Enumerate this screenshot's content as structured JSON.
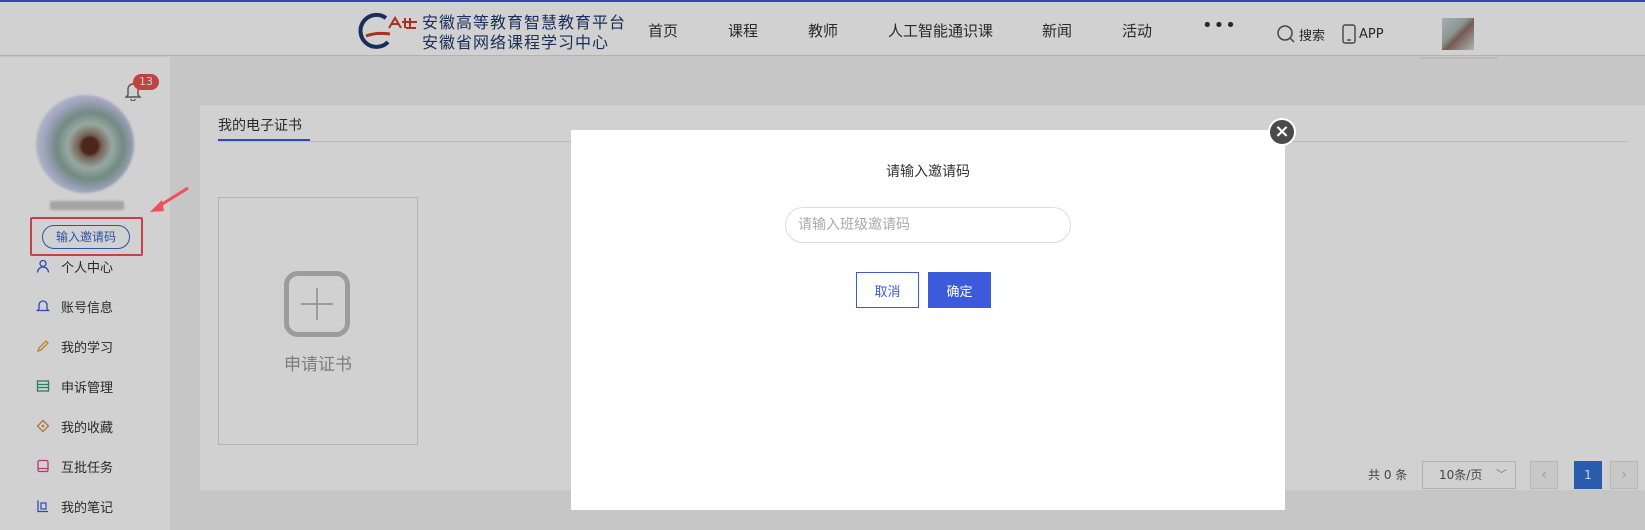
{
  "header": {
    "logo_line1": "安徽高等教育智慧教育平台",
    "logo_line2": "安徽省网络课程学习中心",
    "nav": [
      "首页",
      "课程",
      "教师",
      "人工智能通识课",
      "新闻",
      "活动"
    ],
    "more": "•••",
    "search_label": "搜索",
    "app_label": "APP"
  },
  "sidebar": {
    "notification_count": "13",
    "invite_label": "输入邀请码",
    "items": [
      {
        "label": "个人中心",
        "icon": "user-icon"
      },
      {
        "label": "账号信息",
        "icon": "bell-icon"
      },
      {
        "label": "我的学习",
        "icon": "pencil-icon"
      },
      {
        "label": "申诉管理",
        "icon": "table-icon"
      },
      {
        "label": "我的收藏",
        "icon": "tag-icon"
      },
      {
        "label": "互批任务",
        "icon": "book-icon"
      },
      {
        "label": "我的笔记",
        "icon": "note-icon"
      }
    ]
  },
  "main": {
    "tab": "我的电子证书",
    "card_label": "申请证书",
    "total": "共 0 条",
    "page_size": "10条/页",
    "current_page": "1",
    "prev": "‹",
    "next": "›"
  },
  "modal": {
    "title": "请输入邀请码",
    "input_placeholder": "请输入班级邀请码",
    "input_value": "",
    "cancel_label": "取消",
    "ok_label": "确定",
    "close": "×"
  },
  "colors": {
    "primary": "#3b5bdb",
    "highlight": "#f0505a",
    "badge": "#e95350"
  }
}
